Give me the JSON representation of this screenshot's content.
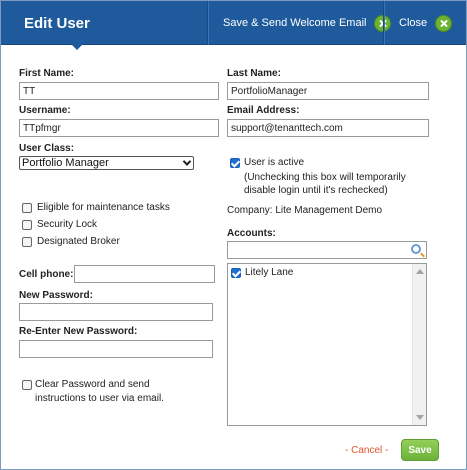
{
  "header": {
    "title": "Edit User",
    "save_send_label": "Save & Send Welcome Email",
    "close_label": "Close"
  },
  "fields": {
    "first_name": {
      "label": "First Name:",
      "value": "TT"
    },
    "last_name": {
      "label": "Last Name:",
      "value": "PortfolioManager"
    },
    "username": {
      "label": "Username:",
      "value": "TTpfmgr"
    },
    "email": {
      "label": "Email Address:",
      "value": "support@tenanttech.com"
    },
    "user_class": {
      "label": "User Class:",
      "value": "Portfolio Manager"
    },
    "cell_phone": {
      "label": "Cell phone:",
      "value": ""
    },
    "new_password": {
      "label": "New Password:",
      "value": ""
    },
    "reenter_password": {
      "label": "Re-Enter New Password:",
      "value": ""
    }
  },
  "checkboxes": {
    "user_active": {
      "label": "User is active",
      "checked": true
    },
    "user_active_note_1": "(Unchecking this box will temporarily",
    "user_active_note_2": "disable login until it's rechecked)",
    "maintenance": {
      "label": "Eligible for maintenance tasks",
      "checked": false
    },
    "security_lock": {
      "label": "Security Lock",
      "checked": false
    },
    "designated_broker": {
      "label": "Designated Broker",
      "checked": false
    },
    "clear_password_line1": "Clear Password and send",
    "clear_password_line2": "instructions to user via email.",
    "clear_password_checked": false
  },
  "company": {
    "text": "Company: Lite Management Demo"
  },
  "accounts": {
    "label": "Accounts:",
    "search_value": "",
    "items": [
      {
        "label": "Litely Lane",
        "checked": true
      }
    ]
  },
  "footer": {
    "cancel_label": "- Cancel -",
    "save_label": "Save"
  },
  "colors": {
    "header_bg": "#1f5b9c",
    "accent_green": "#6cb333",
    "cancel_orange": "#e0562b",
    "checkbox_blue": "#1f6fd1"
  },
  "icons": [
    "close-circle-icon",
    "search-icon",
    "scroll-up-icon",
    "scroll-down-icon",
    "checkmark-icon"
  ]
}
